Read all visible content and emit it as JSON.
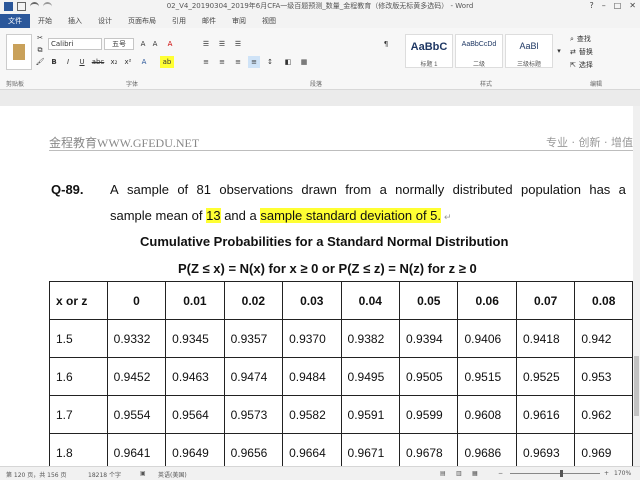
{
  "window": {
    "title": "02_V4_20190304_2019年6月CFA一级百题预测_数量_金程教育（修改版无标黄多选码） - Word",
    "controls": {
      "help": "?",
      "minimize": "–",
      "maximize": "□",
      "close": "✕"
    }
  },
  "ribbon": {
    "tabs": [
      "文件",
      "开始",
      "插入",
      "设计",
      "页面布局",
      "引用",
      "邮件",
      "审阅",
      "视图"
    ],
    "font_name": "Calibri",
    "font_size": "五号",
    "group_labels": [
      "剪贴板",
      "字体",
      "段落",
      "样式",
      "编辑"
    ],
    "styles": [
      {
        "sample": "AaBbC",
        "label": "标题 1"
      },
      {
        "sample": "AaBbCcDd",
        "label": "二级"
      },
      {
        "sample": "AaBl",
        "label": "三级标题"
      }
    ],
    "editing": [
      "查找",
      "替换",
      "选择"
    ],
    "format_buttons": [
      "B",
      "I",
      "U",
      "abc",
      "x₂",
      "x²",
      "A"
    ]
  },
  "page_header": {
    "left": "金程教育WWW.GFEDU.NET",
    "right": "专业 · 创新 · 增值"
  },
  "question": {
    "number": "Q-89.",
    "line1_words": [
      "A",
      "sample",
      "of",
      "81",
      "observations",
      "drawn",
      "from",
      "a",
      "normally",
      "distributed",
      "population",
      "has",
      "a"
    ],
    "line2_prefix": "sample mean of ",
    "mean_value": "13",
    "line2_mid": " and a ",
    "sd_text": "sample standard deviation of 5.",
    "end_mark": "↵"
  },
  "table_title": "Cumulative Probabilities for a Standard Normal Distribution",
  "table_subtitle": "P(Z ≤ x) = N(x) for x ≥ 0 or P(Z ≤ z) = N(z) for z ≥ 0",
  "table": {
    "headers": [
      "x or z",
      "0",
      "0.01",
      "0.02",
      "0.03",
      "0.04",
      "0.05",
      "0.06",
      "0.07",
      "0.08"
    ],
    "rows": [
      [
        "1.5",
        "0.9332",
        "0.9345",
        "0.9357",
        "0.9370",
        "0.9382",
        "0.9394",
        "0.9406",
        "0.9418",
        "0.942"
      ],
      [
        "1.6",
        "0.9452",
        "0.9463",
        "0.9474",
        "0.9484",
        "0.9495",
        "0.9505",
        "0.9515",
        "0.9525",
        "0.953"
      ],
      [
        "1.7",
        "0.9554",
        "0.9564",
        "0.9573",
        "0.9582",
        "0.9591",
        "0.9599",
        "0.9608",
        "0.9616",
        "0.962"
      ],
      [
        "1.8",
        "0.9641",
        "0.9649",
        "0.9656",
        "0.9664",
        "0.9671",
        "0.9678",
        "0.9686",
        "0.9693",
        "0.969"
      ]
    ]
  },
  "status_bar": {
    "page": "第 120 页，共 156 页",
    "words": "18218 个字",
    "language": "英语(美国)",
    "zoom": "170%"
  },
  "colors": {
    "file_tab": "#2b579a",
    "highlight": "#ffff33"
  }
}
